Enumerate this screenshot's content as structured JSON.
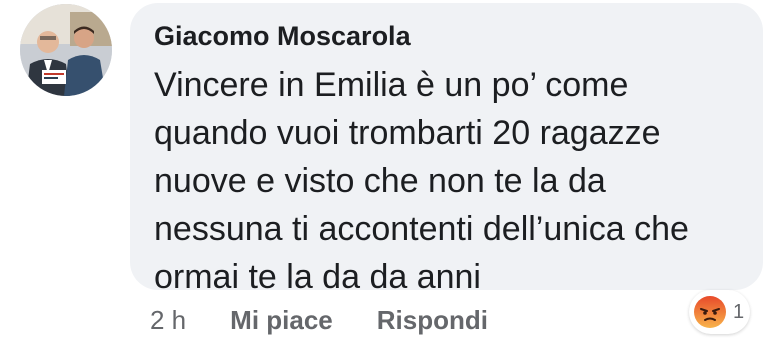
{
  "comment": {
    "author": "Giacomo Moscarola",
    "text_lines": [
      "Vincere in Emilia è un po’ come",
      "quando vuoi trombarti 20 ragazze",
      "nuove e visto che non te la da",
      "nessuna ti accontenti dell’unica che",
      "ormai te la da da anni"
    ],
    "timestamp": "2 h",
    "like_label": "Mi piace",
    "reply_label": "Rispondi",
    "reaction": {
      "icon": "angry-reaction-icon",
      "count": "1",
      "color": "#f0603f"
    }
  },
  "colors": {
    "bubble": "#f0f2f5",
    "text": "#1c1e21",
    "secondary": "#65676b"
  }
}
